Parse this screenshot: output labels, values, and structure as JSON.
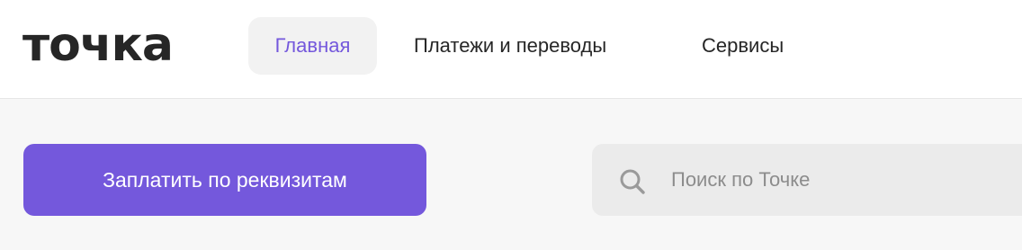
{
  "header": {
    "logo_text": "точка",
    "nav": [
      {
        "label": "Главная",
        "active": true
      },
      {
        "label": "Платежи и переводы",
        "active": false
      },
      {
        "label": "Сервисы",
        "active": false
      }
    ]
  },
  "main": {
    "pay_button_label": "Заплатить по реквизитам",
    "search": {
      "placeholder": "Поиск по Точке",
      "value": "",
      "icon": "search-icon"
    }
  },
  "colors": {
    "accent": "#7458dc",
    "text": "#262626",
    "muted": "#8c8c8c",
    "header_bg": "#ffffff",
    "page_bg": "#f7f7f7",
    "field_bg": "#ebebeb",
    "active_tab_bg": "#f2f2f2"
  }
}
